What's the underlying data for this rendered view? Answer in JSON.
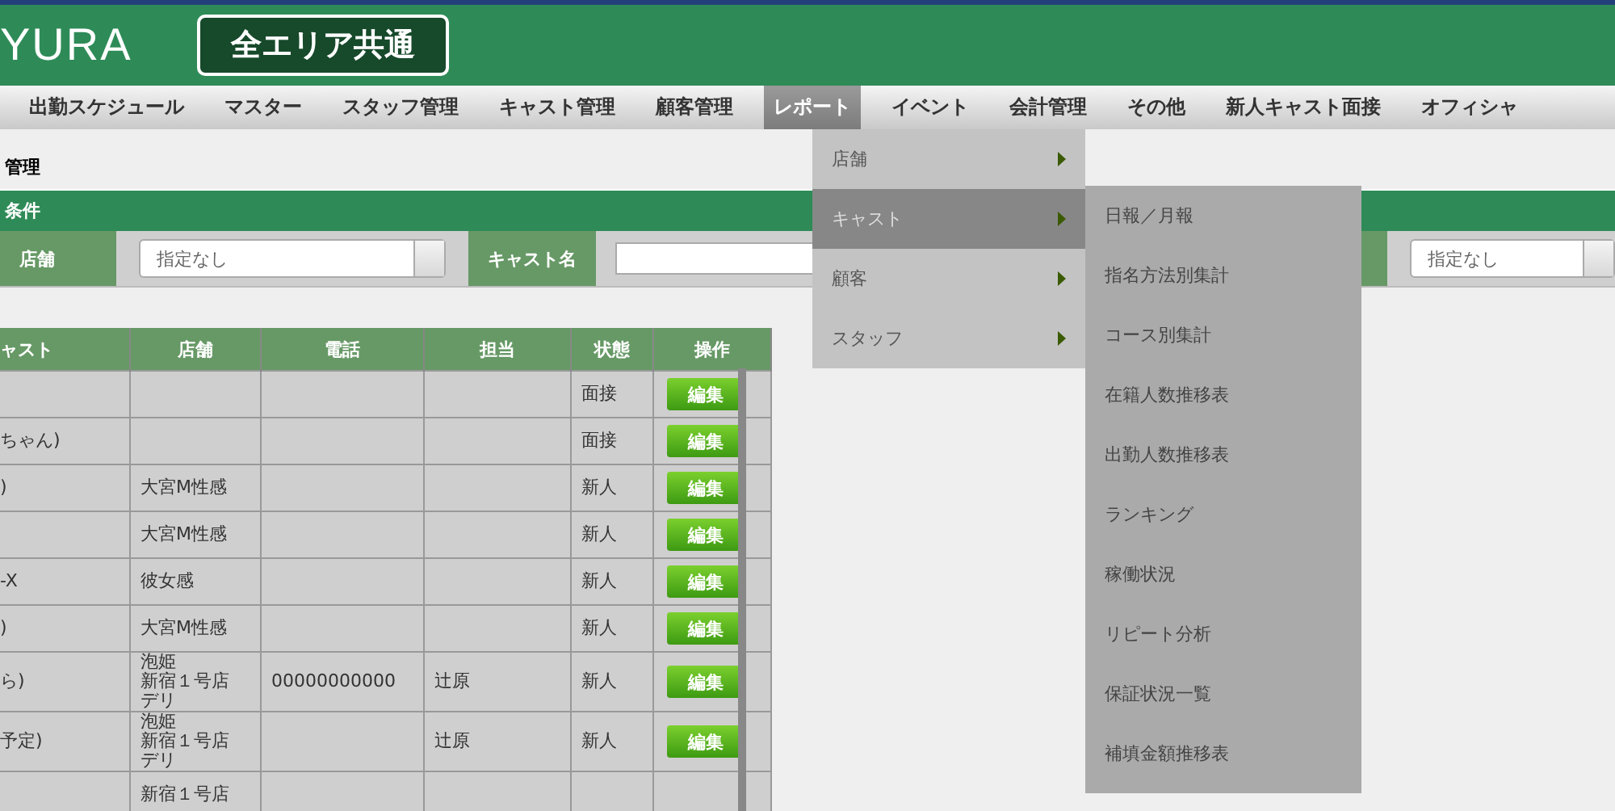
{
  "header": {
    "logo": "YURA",
    "area_button": "全エリア共通"
  },
  "nav": [
    {
      "label": "出勤スケジュール",
      "selected": false
    },
    {
      "label": "マスター",
      "selected": false
    },
    {
      "label": "スタッフ管理",
      "selected": false
    },
    {
      "label": "キャスト管理",
      "selected": false
    },
    {
      "label": "顧客管理",
      "selected": false
    },
    {
      "label": "レポート",
      "selected": true
    },
    {
      "label": "イベント",
      "selected": false
    },
    {
      "label": "会計管理",
      "selected": false
    },
    {
      "label": "その他",
      "selected": false
    },
    {
      "label": "新人キャスト面接",
      "selected": false
    },
    {
      "label": "オフィシャ",
      "selected": false
    }
  ],
  "breadcrumb": "管理",
  "conditions": {
    "title": "条件",
    "fields": [
      {
        "kind": "select",
        "label": "店舗",
        "value": "指定なし"
      },
      {
        "kind": "text",
        "label": "キャスト名"
      },
      {
        "kind": "select",
        "value": "指定なし"
      }
    ]
  },
  "table": {
    "columns": [
      "ャスト",
      "店舗",
      "電話",
      "担当",
      "状態",
      "操作"
    ],
    "rows": [
      {
        "cells": [
          "",
          "",
          "",
          "",
          "面接"
        ],
        "action": "編集"
      },
      {
        "cells": [
          "ちゃん)",
          "",
          "",
          "",
          "面接"
        ],
        "action": "編集"
      },
      {
        "cells": [
          ")",
          "大宮M性感",
          "",
          "",
          "新人"
        ],
        "action": "編集"
      },
      {
        "cells": [
          "",
          "大宮M性感",
          "",
          "",
          "新人"
        ],
        "action": "編集"
      },
      {
        "cells": [
          "-X",
          "彼女感",
          "",
          "",
          "新人"
        ],
        "action": "編集"
      },
      {
        "cells": [
          ")",
          "大宮M性感",
          "",
          "",
          "新人"
        ],
        "action": "編集"
      },
      {
        "cells": [
          "ら)",
          [
            "泡姫",
            "新宿１号店",
            "デリ"
          ],
          "00000000000",
          "辻原",
          "新人"
        ],
        "action": "編集"
      },
      {
        "cells": [
          "予定)",
          [
            "泡姫",
            "新宿１号店",
            "デリ"
          ],
          "",
          "辻原",
          "新人"
        ],
        "action": "編集"
      },
      {
        "cells": [
          "",
          "新宿１号店",
          "",
          "",
          ""
        ]
      }
    ]
  },
  "menu": {
    "items": [
      {
        "label": "店舗",
        "selected": false
      },
      {
        "label": "キャスト",
        "selected": true
      },
      {
        "label": "顧客",
        "selected": false
      },
      {
        "label": "スタッフ",
        "selected": false
      }
    ],
    "submenu": [
      "日報／月報",
      "指名方法別集計",
      "コース別集計",
      "在籍人数推移表",
      "出勤人数推移表",
      "ランキング",
      "稼働状況",
      "リピート分析",
      "保証状況一覧",
      "補填金額推移表"
    ]
  }
}
